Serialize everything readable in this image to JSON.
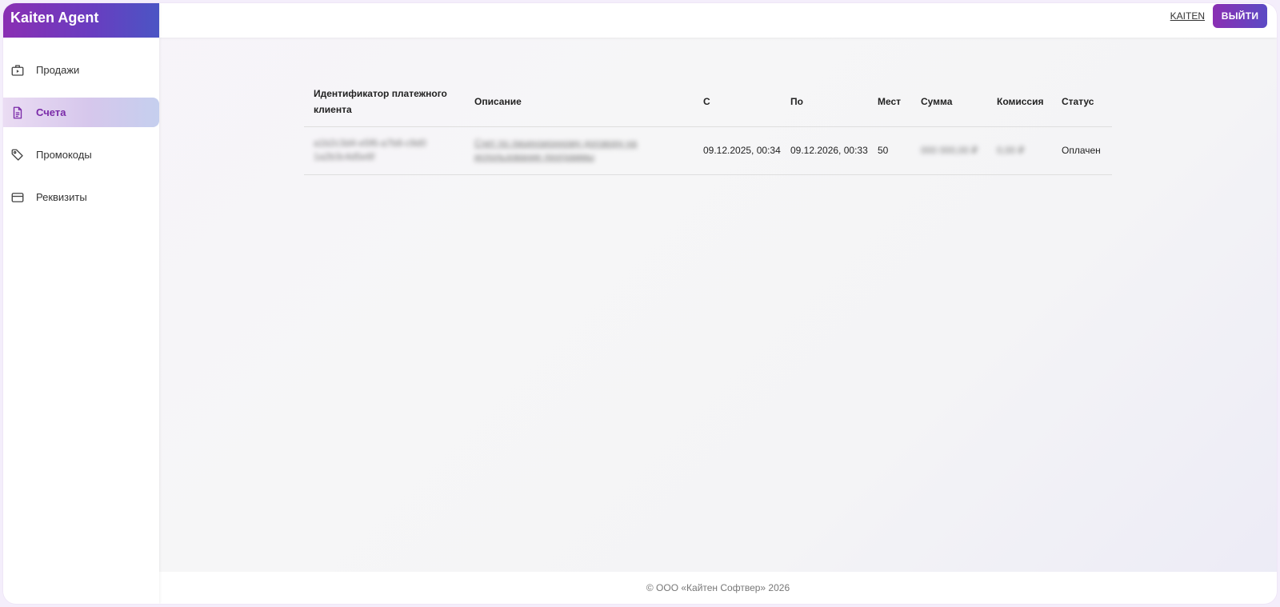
{
  "app": {
    "brand": "Kaiten Agent"
  },
  "sidebar": {
    "items": [
      {
        "label": "Продажи",
        "icon": "store-icon",
        "active": false
      },
      {
        "label": "Счета",
        "icon": "document-icon",
        "active": true
      },
      {
        "label": "Промокоды",
        "icon": "tag-icon",
        "active": false
      },
      {
        "label": "Реквизиты",
        "icon": "credit-card-icon",
        "active": false
      }
    ]
  },
  "topbar": {
    "link_label": "KAITEN",
    "logout_label": "ВЫЙТИ"
  },
  "invoices": {
    "columns": {
      "client_id": "Идентификатор платежного клиента",
      "description": "Описание",
      "from": "С",
      "to": "По",
      "seats": "Мест",
      "amount": "Сумма",
      "commission": "Комиссия",
      "status": "Статус"
    },
    "rows": [
      {
        "client_id": "a1b2c3d4-e5f6-a7b8-c9d0 1a2b3c4d5e6f",
        "description": "Счет по лицензионному договору на использование программы",
        "from": "09.12.2025, 00:34",
        "to": "09.12.2026, 00:33",
        "seats": "50",
        "amount": "000 000,00 ₽",
        "commission": "0,00 ₽",
        "status": "Оплачен"
      }
    ]
  },
  "footer": {
    "copyright": "© ООО «Кайтен Софтвер» 2026"
  },
  "colors": {
    "accent": "#8a2fb3",
    "accent_secondary": "#4b55c4"
  }
}
